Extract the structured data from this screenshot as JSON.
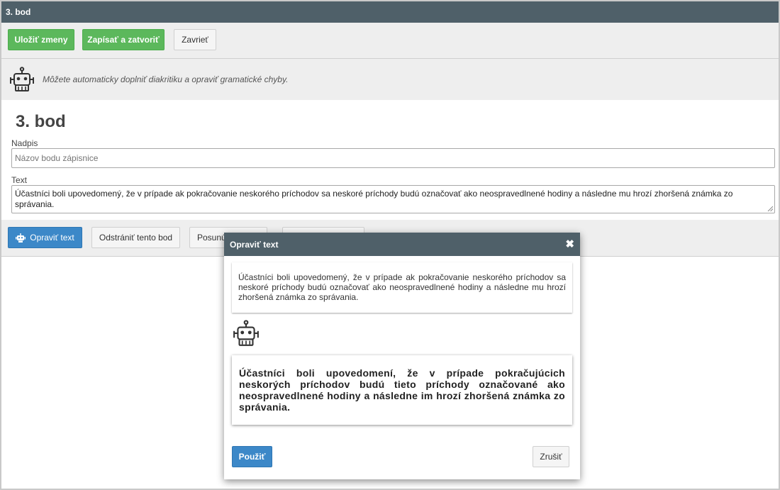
{
  "window": {
    "title": "3. bod"
  },
  "toolbar": {
    "save_label": "Uložiť zmeny",
    "save_close_label": "Zapísať a zatvoriť",
    "close_label": "Zavrieť"
  },
  "hint": {
    "text": "Môžete automaticky doplniť diakritiku a opraviť gramatické chyby.",
    "icon": "robot-icon"
  },
  "form": {
    "title": "3. bod",
    "heading_label": "Nadpis",
    "heading_placeholder": "Názov bodu zápisnice",
    "text_label": "Text",
    "text_value": "Účastníci boli upovedomený, že v prípade ak pokračovanie neskorého príchodov sa neskoré príchody budú označovať ako neospravedlnené hodiny a následne mu hrozí zhoršená známka zo správania."
  },
  "actions": {
    "fix_text_label": "Opraviť text",
    "remove_label": "Odstrániť tento bod",
    "move_label": "Posunú"
  },
  "modal": {
    "title": "Opraviť text",
    "original_text": "Účastníci boli upovedomený, že v prípade ak pokračovanie neskorého príchodov sa neskoré príchody budú označovať ako neospravedlnené hodiny a následne mu hrozí zhoršená známka zo správania.",
    "corrected_text": "Účastníci boli upovedomení, že v prípade pokračujúcich neskorých príchodov budú tieto príchody označované ako neospravedlnené hodiny a následne im hrozí zhoršená známka zo správania.",
    "apply_label": "Použiť",
    "cancel_label": "Zrušiť"
  },
  "colors": {
    "header_bg": "#4f6069",
    "success": "#5cb85c",
    "primary": "#3c88c8",
    "panel_bg": "#eeeeee"
  }
}
